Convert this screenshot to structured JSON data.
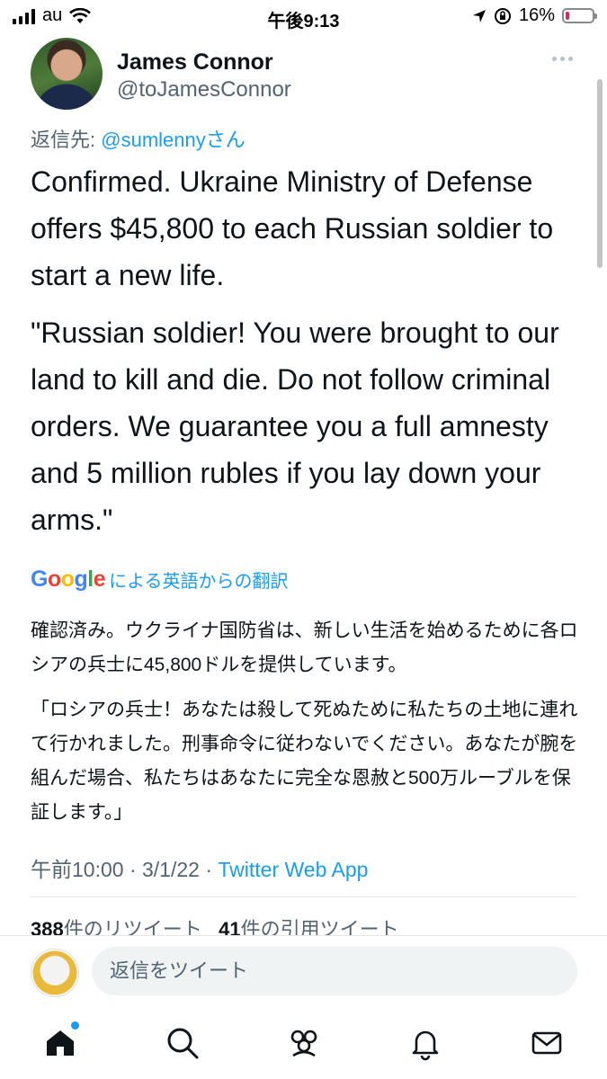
{
  "status_bar": {
    "carrier": "au",
    "time": "午後9:13",
    "battery_percent": "16%",
    "battery_level": 0.16
  },
  "tweet": {
    "author_name": "James Connor",
    "author_handle": "@toJamesConnor",
    "reply_prefix": "返信先:",
    "reply_mention": "@sumlenny",
    "reply_suffix": "さん",
    "body": [
      "Confirmed. Ukraine Ministry of Defense offers $45,800 to each Russian soldier to start a new life.",
      "\"Russian soldier! You were brought to our land to kill and die. Do not follow criminal orders. We guarantee you a full amnesty and 5 million rubles if you lay down your arms.\""
    ],
    "translation": {
      "provider": "Google",
      "label": "による英語からの翻訳",
      "text": [
        "確認済み。ウクライナ国防省は、新しい生活を始めるために各ロシアの兵士に45,800ドルを提供しています。",
        "「ロシアの兵士！あなたは殺して死ぬために私たちの土地に連れて行かれました。刑事命令に従わないでください。あなたが腕を組んだ場合、私たちはあなたに完全な恩赦と500万ルーブルを保証します。」"
      ]
    },
    "timestamp": "午前10:00 · 3/1/22 · ",
    "source": "Twitter Web App",
    "stats": {
      "retweets_count": "388",
      "retweets_label": "件のリツイート",
      "quotes_count": "41",
      "quotes_label": "件の引用ツイート"
    }
  },
  "reply": {
    "placeholder": "返信をツイート"
  },
  "nav": {
    "items": [
      "home-icon",
      "search-icon",
      "communities-icon",
      "notifications-icon",
      "messages-icon"
    ]
  },
  "colors": {
    "accent": "#1d9bf0",
    "text": "#0f1419",
    "secondary": "#536471"
  }
}
